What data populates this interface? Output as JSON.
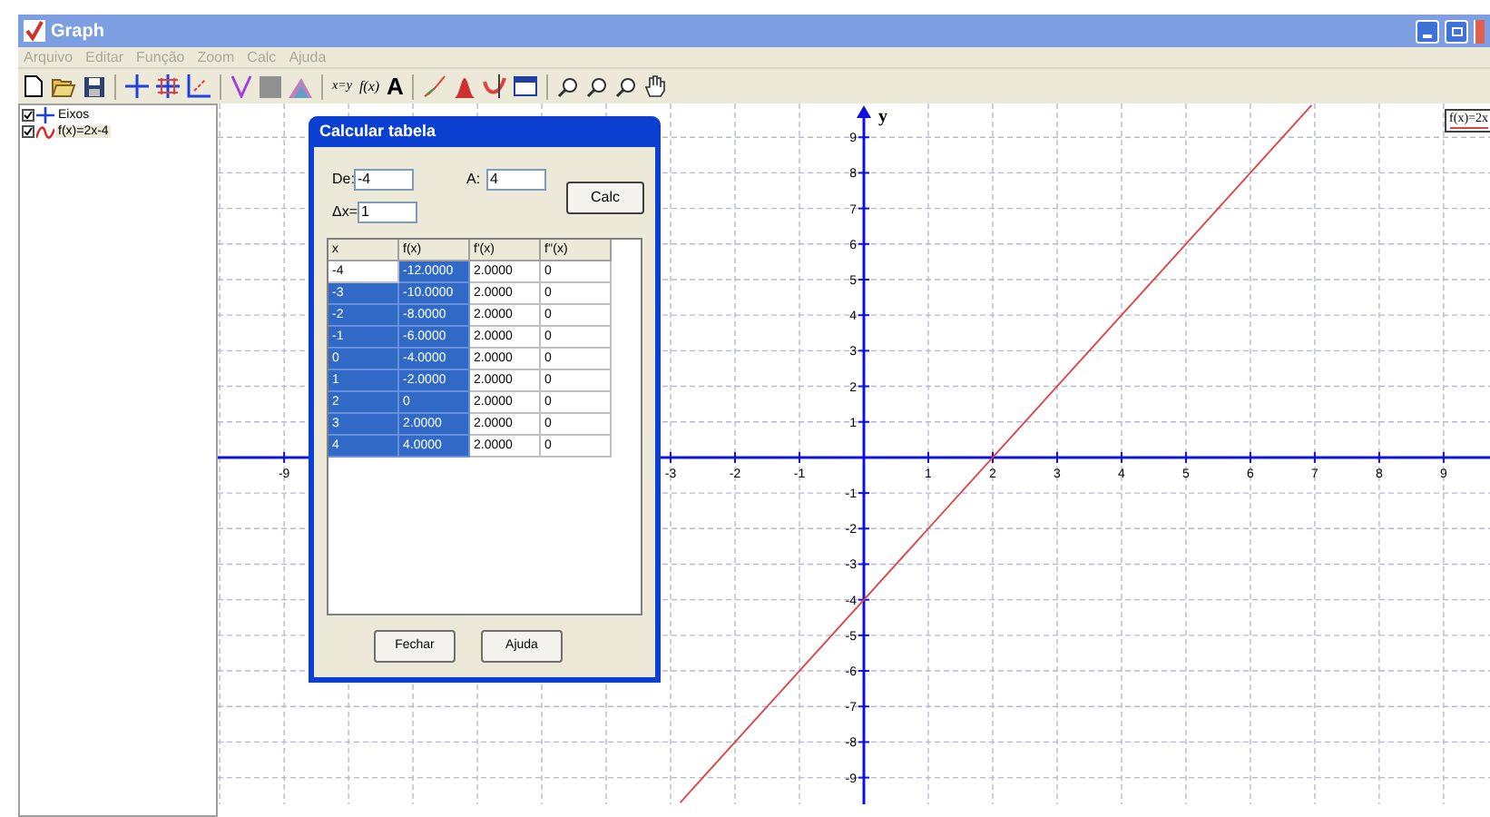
{
  "window": {
    "title": "Graph",
    "active": false
  },
  "menu": [
    {
      "label": "Arquivo",
      "disabled": true
    },
    {
      "label": "Editar",
      "disabled": true
    },
    {
      "label": "Função",
      "disabled": true
    },
    {
      "label": "Zoom",
      "disabled": true
    },
    {
      "label": "Calc",
      "disabled": true
    },
    {
      "label": "Ajuda",
      "disabled": true
    }
  ],
  "toolbar_texts": [
    "x=y",
    "f(x)",
    "A"
  ],
  "sidebar": {
    "items": [
      {
        "label": "Eixos",
        "kind": "axes",
        "checked": true,
        "selected": false
      },
      {
        "label": "f(x)=2x-4",
        "kind": "function",
        "checked": true,
        "selected": true
      }
    ]
  },
  "graph": {
    "chart_data": {
      "type": "line",
      "grid": true,
      "ylabel": "y",
      "x": [
        -2.85,
        6.95
      ],
      "series": [
        {
          "name": "f(x)=2x",
          "color": "#e04040",
          "values": [
            -9.7,
            9.9
          ]
        }
      ],
      "xlim": [
        -10.03,
        9.72
      ],
      "ylim": [
        -9.75,
        9.95
      ],
      "xticks": [
        -9,
        -3,
        -2,
        -1,
        1,
        2,
        3,
        4,
        5,
        6,
        7,
        8,
        9
      ],
      "yticks": [
        -9,
        -8,
        -7,
        -6,
        -5,
        -4,
        -3,
        -2,
        -1,
        1,
        2,
        3,
        4,
        5,
        6,
        7,
        8,
        9
      ]
    }
  },
  "dialog": {
    "title": "Calcular tabela",
    "active": true,
    "from": {
      "label": "De:",
      "value": "-4"
    },
    "to": {
      "label": "A:",
      "value": "4"
    },
    "step": {
      "label": "Δx=",
      "value": "1"
    },
    "calc_button": "Calc",
    "table": {
      "columns": [
        "x",
        "f(x)",
        "f'(x)",
        "f''(x)"
      ],
      "rows": [
        {
          "cells": [
            {
              "text": "-4",
              "selected": false
            },
            {
              "text": "-12.0000",
              "selected": true
            },
            {
              "text": "2.0000",
              "selected": false
            },
            {
              "text": "0",
              "selected": false
            }
          ]
        },
        {
          "cells": [
            {
              "text": "-3",
              "selected": true
            },
            {
              "text": "-10.0000",
              "selected": true
            },
            {
              "text": "2.0000",
              "selected": false
            },
            {
              "text": "0",
              "selected": false
            }
          ]
        },
        {
          "cells": [
            {
              "text": "-2",
              "selected": true
            },
            {
              "text": "-8.0000",
              "selected": true
            },
            {
              "text": "2.0000",
              "selected": false
            },
            {
              "text": "0",
              "selected": false
            }
          ]
        },
        {
          "cells": [
            {
              "text": "-1",
              "selected": true
            },
            {
              "text": "-6.0000",
              "selected": true
            },
            {
              "text": "2.0000",
              "selected": false
            },
            {
              "text": "0",
              "selected": false
            }
          ]
        },
        {
          "cells": [
            {
              "text": "0",
              "selected": true
            },
            {
              "text": "-4.0000",
              "selected": true
            },
            {
              "text": "2.0000",
              "selected": false
            },
            {
              "text": "0",
              "selected": false
            }
          ]
        },
        {
          "cells": [
            {
              "text": "1",
              "selected": true
            },
            {
              "text": "-2.0000",
              "selected": true
            },
            {
              "text": "2.0000",
              "selected": false
            },
            {
              "text": "0",
              "selected": false
            }
          ]
        },
        {
          "cells": [
            {
              "text": "2",
              "selected": true
            },
            {
              "text": "0",
              "selected": true
            },
            {
              "text": "2.0000",
              "selected": false
            },
            {
              "text": "0",
              "selected": false
            }
          ]
        },
        {
          "cells": [
            {
              "text": "3",
              "selected": true
            },
            {
              "text": "2.0000",
              "selected": true
            },
            {
              "text": "2.0000",
              "selected": false
            },
            {
              "text": "0",
              "selected": false
            }
          ]
        },
        {
          "cells": [
            {
              "text": "4",
              "selected": true
            },
            {
              "text": "4.0000",
              "selected": true
            },
            {
              "text": "2.0000",
              "selected": false
            },
            {
              "text": "0",
              "selected": false
            }
          ]
        }
      ]
    },
    "buttons": [
      "Fechar",
      "Ajuda"
    ]
  }
}
